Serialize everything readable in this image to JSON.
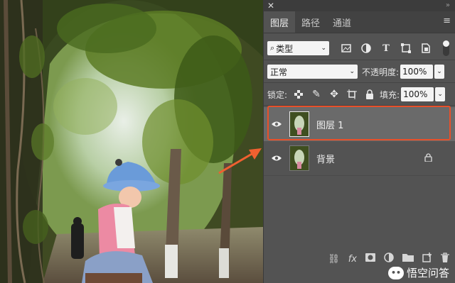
{
  "panel": {
    "close_glyph": "✕",
    "tabs": [
      {
        "label": "图层",
        "active": true
      },
      {
        "label": "路径",
        "active": false
      },
      {
        "label": "通道",
        "active": false
      }
    ],
    "menu_glyph": "≡"
  },
  "filter": {
    "label": "类型",
    "icons": [
      "image-filter-icon",
      "adjustment-filter-icon",
      "type-filter-icon",
      "shape-filter-icon",
      "smart-object-filter-icon"
    ]
  },
  "blend": {
    "mode": "正常",
    "opacity_label": "不透明度:",
    "opacity_value": "100%"
  },
  "lock": {
    "label": "锁定:",
    "fill_label": "填充:",
    "fill_value": "100%"
  },
  "layers": [
    {
      "name": "图层 1",
      "selected": true,
      "visible": true,
      "locked": false
    },
    {
      "name": "背景",
      "selected": false,
      "visible": true,
      "locked": true
    }
  ],
  "footer": {
    "fx_label": "fx"
  },
  "watermark": {
    "text": "悟空问答"
  },
  "colors": {
    "panel_bg": "#535353",
    "selected_row": "#6a6a6a",
    "highlight_border": "#e8502a",
    "arrow": "#f06030"
  }
}
